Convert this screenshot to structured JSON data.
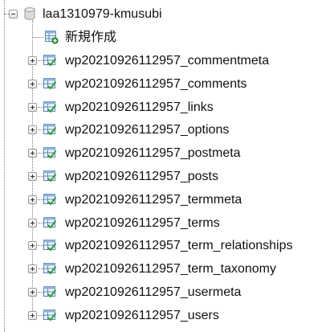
{
  "tree": {
    "root": {
      "label": "laa1310979-kmusubi",
      "icon": "database-icon",
      "expanded": true
    },
    "new_item": {
      "label": "新規作成",
      "icon": "new-table-icon"
    },
    "tables": [
      {
        "label": "wp20210926112957_commentmeta"
      },
      {
        "label": "wp20210926112957_comments"
      },
      {
        "label": "wp20210926112957_links"
      },
      {
        "label": "wp20210926112957_options"
      },
      {
        "label": "wp20210926112957_postmeta"
      },
      {
        "label": "wp20210926112957_posts"
      },
      {
        "label": "wp20210926112957_termmeta"
      },
      {
        "label": "wp20210926112957_terms"
      },
      {
        "label": "wp20210926112957_term_relationships"
      },
      {
        "label": "wp20210926112957_term_taxonomy"
      },
      {
        "label": "wp20210926112957_usermeta"
      },
      {
        "label": "wp20210926112957_users"
      }
    ],
    "table_icon": "table-icon",
    "expander_icon": "expand-plus-icon"
  },
  "colors": {
    "connector": "#7a7a7a",
    "table_icon_blue": "#2b6fc4",
    "table_icon_green": "#2f9a3a"
  }
}
